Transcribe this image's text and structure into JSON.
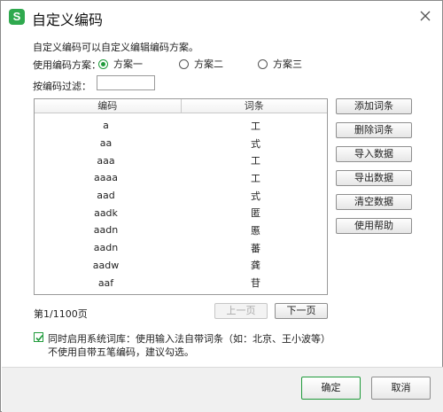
{
  "window": {
    "title": "自定义编码",
    "logo_letter": "S",
    "accent_color": "#2fa94e"
  },
  "description": "自定义编码可以自定义编辑编码方案。",
  "scheme": {
    "label": "使用编码方案：",
    "options": [
      "方案一",
      "方案二",
      "方案三"
    ],
    "selected": "方案一"
  },
  "filter": {
    "label": "按编码过滤：",
    "value": ""
  },
  "table": {
    "headers": [
      "编码",
      "词条"
    ],
    "rows": [
      {
        "code": "a",
        "word": "工"
      },
      {
        "code": "aa",
        "word": "式"
      },
      {
        "code": "aaa",
        "word": "工"
      },
      {
        "code": "aaaa",
        "word": "工"
      },
      {
        "code": "aad",
        "word": "式"
      },
      {
        "code": "aadk",
        "word": "匿"
      },
      {
        "code": "aadn",
        "word": "慝"
      },
      {
        "code": "aadn",
        "word": "蕃"
      },
      {
        "code": "aadw",
        "word": "龚"
      },
      {
        "code": "aaf",
        "word": "苷"
      }
    ]
  },
  "side_buttons": {
    "add": "添加词条",
    "delete": "删除词条",
    "import": "导入数据",
    "export": "导出数据",
    "clear": "清空数据",
    "help": "使用帮助"
  },
  "pagination": {
    "info": "第1/1100页",
    "prev": "上一页",
    "next": "下一页"
  },
  "system_lexicon": {
    "checked": true,
    "line1": "同时启用系统词库：使用输入法自带词条（如：北京、王小波等）",
    "line2": "不使用自带五笔编码，建议勾选。"
  },
  "footer": {
    "ok": "确定",
    "cancel": "取消"
  }
}
